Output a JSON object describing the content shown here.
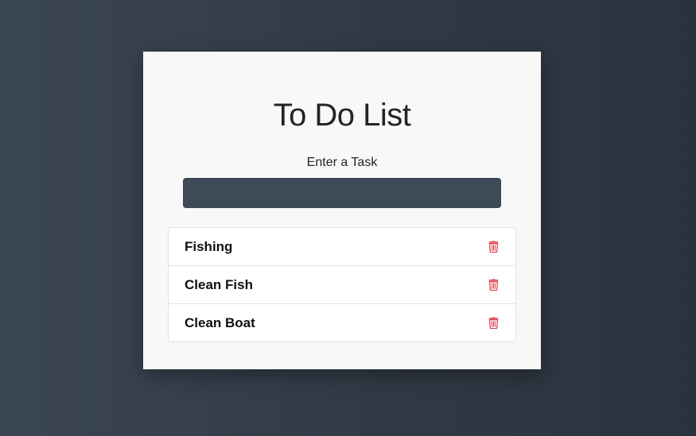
{
  "app": {
    "title": "To Do List",
    "input_label": "Enter a Task",
    "input_value": "",
    "input_placeholder": ""
  },
  "tasks": [
    {
      "label": "Fishing",
      "delete_icon": "trash-icon"
    },
    {
      "label": "Clean Fish",
      "delete_icon": "trash-icon"
    },
    {
      "label": "Clean Boat",
      "delete_icon": "trash-icon"
    }
  ],
  "colors": {
    "delete": "#dc3545",
    "input_bg": "#3e4a57",
    "card_bg": "#f8f8f8"
  }
}
